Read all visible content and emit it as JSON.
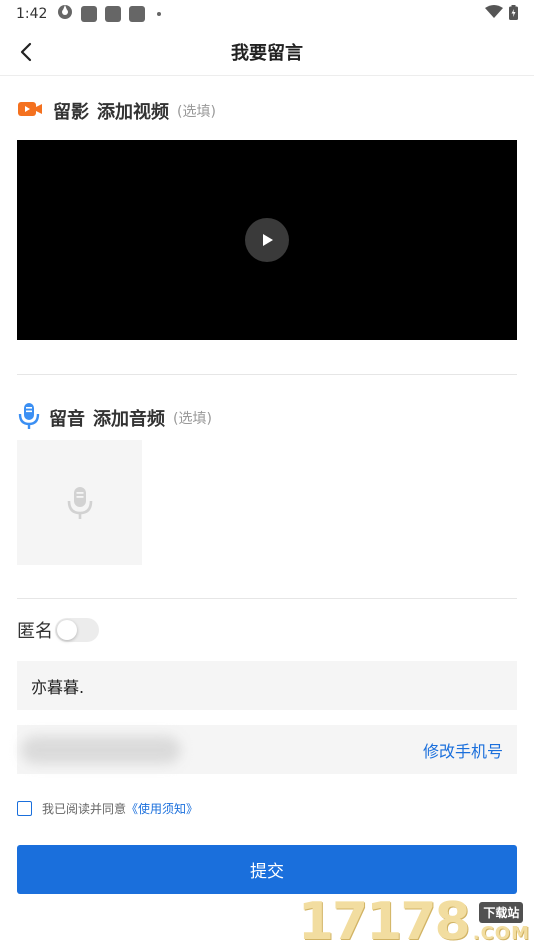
{
  "status_bar": {
    "time": "1:42"
  },
  "nav": {
    "title": "我要留言"
  },
  "video_section": {
    "label_prefix": "留影",
    "label_main": "添加视频",
    "hint": "(选填)",
    "icon_color": "#f4711f"
  },
  "audio_section": {
    "label_prefix": "留音",
    "label_main": "添加音频",
    "hint": "(选填)",
    "icon_color": "#3b8ff3"
  },
  "anonymous": {
    "label": "匿名",
    "enabled": false
  },
  "name_field": {
    "value": "亦暮暮."
  },
  "phone_field": {
    "edit_label": "修改手机号"
  },
  "agreement": {
    "text": "我已阅读并同意",
    "link": "《使用须知》",
    "checked": false
  },
  "submit": {
    "label": "提交"
  },
  "watermark": {
    "number": "17178",
    "badge": "下载站",
    "suffix": ".COM"
  },
  "colors": {
    "accent": "#1a6fdc",
    "field_bg": "#f5f5f5"
  }
}
